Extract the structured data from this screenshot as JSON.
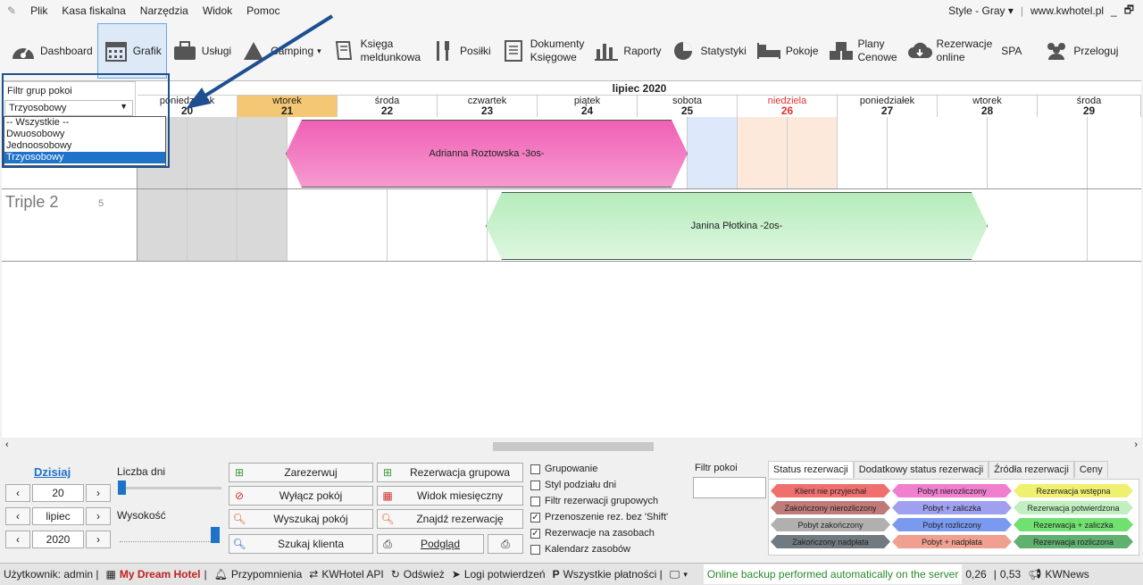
{
  "menu": {
    "items": [
      "Plik",
      "Kasa fiskalna",
      "Narzędzia",
      "Widok",
      "Pomoc"
    ],
    "style": "Style - Gray",
    "website": "www.kwhotel.pl"
  },
  "toolbar": {
    "dashboard": "Dashboard",
    "grafik": "Grafik",
    "uslugi": "Usługi",
    "camping": "Camping",
    "ksiega_1": "Księga",
    "ksiega_2": "meldunkowa",
    "posilki": "Posiłki",
    "dok_1": "Dokumenty",
    "dok_2": "Księgowe",
    "raporty": "Raporty",
    "statystyki": "Statystyki",
    "pokoje": "Pokoje",
    "plany_1": "Plany",
    "plany_2": "Cenowe",
    "rez_1": "Rezerwacje",
    "rez_2": "online",
    "spa": "SPA",
    "przeloguj": "Przeloguj"
  },
  "filter": {
    "title": "Filtr grup pokoi",
    "selected": "Trzyosobowy",
    "options": [
      "-- Wszystkie --",
      "Dwuosobowy",
      "Jednoosobowy",
      "Trzyosobowy"
    ]
  },
  "calendar": {
    "month": "lipiec 2020",
    "days": [
      {
        "name": "poniedziałek",
        "num": "20"
      },
      {
        "name": "wtorek",
        "num": "21"
      },
      {
        "name": "środa",
        "num": "22"
      },
      {
        "name": "czwartek",
        "num": "23"
      },
      {
        "name": "piątek",
        "num": "24"
      },
      {
        "name": "sobota",
        "num": "25"
      },
      {
        "name": "niedziela",
        "num": "26"
      },
      {
        "name": "poniedziałek",
        "num": "27"
      },
      {
        "name": "wtorek",
        "num": "28"
      },
      {
        "name": "środa",
        "num": "29"
      }
    ],
    "rooms": [
      {
        "name": "",
        "capacity": ""
      },
      {
        "name": "Triple 2",
        "capacity": "5"
      }
    ],
    "reservations": [
      {
        "guest": "Adrianna Roztowska -3os-",
        "color": "#f06fb9"
      },
      {
        "guest": "Janina Płotkina -2os-",
        "color": "#c9f0cc"
      }
    ]
  },
  "bottom": {
    "today": "Dzisiaj",
    "days_count_label": "Liczba dni",
    "height_label": "Wysokość",
    "day_value": "20",
    "month_value": "lipiec",
    "year_value": "2020",
    "buttons": {
      "zarezerwuj": "Zarezerwuj",
      "wylacz": "Wyłącz pokój",
      "wyszukaj_pokoj": "Wyszukaj pokój",
      "szukaj_klienta": "Szukaj klienta",
      "rez_grupowa": "Rezerwacja grupowa",
      "widok_mies": "Widok miesięczny",
      "znajdz": "Znajdź rezerwację",
      "podglad": "Podgląd"
    },
    "checkboxes": [
      {
        "label": "Grupowanie",
        "checked": false
      },
      {
        "label": "Styl podziału dni",
        "checked": false
      },
      {
        "label": "Filtr rezerwacji grupowych",
        "checked": false
      },
      {
        "label": "Przenoszenie rez. bez 'Shift'",
        "checked": true
      },
      {
        "label": "Rezerwacje na zasobach",
        "checked": true
      },
      {
        "label": "Kalendarz zasobów",
        "checked": false
      }
    ],
    "filter_rooms_label": "Filtr pokoi",
    "tabs": [
      "Status rezerwacji",
      "Dodatkowy status rezerwacji",
      "Źródła rezerwacji",
      "Ceny"
    ],
    "legend": [
      {
        "label": "Klient nie przyjechał",
        "color": "#f07070"
      },
      {
        "label": "Pobyt nierozliczony",
        "color": "#f07fd0"
      },
      {
        "label": "Rezerwacja wstępna",
        "color": "#f0f070"
      },
      {
        "label": "Zakończony nierozliczony",
        "color": "#c07a7a"
      },
      {
        "label": "Pobyt + zaliczka",
        "color": "#a0a0f0"
      },
      {
        "label": "Rezerwacja potwierdzona",
        "color": "#c0f0c0"
      },
      {
        "label": "Pobyt zakończony",
        "color": "#b0b0b0"
      },
      {
        "label": "Pobyt rozliczony",
        "color": "#7a9af0"
      },
      {
        "label": "Rezerwacja + zaliczka",
        "color": "#70e070"
      },
      {
        "label": "Zakończony nadpłata",
        "color": "#707a80"
      },
      {
        "label": "Pobyt + nadpłata",
        "color": "#f0a090"
      },
      {
        "label": "Rezerwacja rozliczona",
        "color": "#60b070"
      }
    ]
  },
  "statusbar": {
    "user": "Użytkownik: admin |",
    "hotel": "My Dream Hotel",
    "reminders": "Przypomnienia",
    "api": "KWHotel API",
    "refresh": "Odśwież",
    "logs": "Logi potwierdzeń",
    "payments": "Wszystkie płatności |",
    "backup": "Online backup performed automatically on the server",
    "v1": "0,26",
    "v2": "0,53",
    "news": "KWNews"
  },
  "colors": {
    "accent": "#1e73c8",
    "today": "#f4c774",
    "sunday": "#e53030",
    "highlight": "#1d4f91"
  }
}
